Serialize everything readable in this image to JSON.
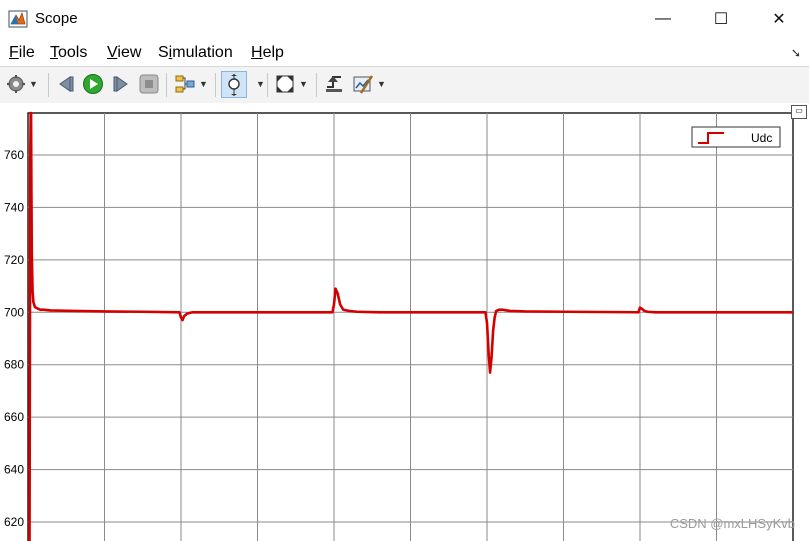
{
  "window": {
    "title": "Scope"
  },
  "window_controls": {
    "minimize": "—",
    "maximize": "☐",
    "close": "✕"
  },
  "menu": [
    {
      "label": "File",
      "accel": "F"
    },
    {
      "label": "Tools",
      "accel": "T"
    },
    {
      "label": "View",
      "accel": "V"
    },
    {
      "label": "Simulation",
      "accel": "i"
    },
    {
      "label": "Help",
      "accel": "H"
    }
  ],
  "toolbar": {
    "icons": [
      "settings-icon",
      "step-back-icon",
      "run-icon",
      "step-forward-icon",
      "stop-icon",
      "signal-select-icon",
      "zoom-icon",
      "autoscale-icon",
      "cursor-measure-icon",
      "style-icon"
    ]
  },
  "watermark": "CSDN @mxLHSyKvb",
  "chart_data": {
    "type": "line",
    "title": "",
    "xlabel": "",
    "ylabel": "",
    "ylim": [
      612,
      776
    ],
    "yticks": [
      620,
      640,
      660,
      680,
      700,
      720,
      740,
      760
    ],
    "x_grid_divisions": 10,
    "grid": true,
    "legend": {
      "placement": "top-right",
      "entries": [
        "Udc"
      ]
    },
    "series": [
      {
        "name": "Udc",
        "color": "#d40000",
        "x": [
          0.0,
          0.02,
          0.03,
          0.035,
          0.04,
          0.045,
          0.05,
          0.06,
          0.07,
          0.09,
          0.12,
          0.16,
          0.2,
          0.3,
          0.6,
          1.0,
          1.5,
          1.98,
          2.0,
          2.02,
          2.04,
          2.08,
          2.15,
          2.3,
          2.6,
          3.0,
          3.5,
          3.98,
          4.0,
          4.02,
          4.05,
          4.08,
          4.12,
          4.2,
          4.3,
          4.6,
          5.0,
          5.5,
          5.98,
          6.0,
          6.02,
          6.04,
          6.06,
          6.08,
          6.1,
          6.12,
          6.16,
          6.2,
          6.3,
          6.5,
          7.0,
          7.5,
          7.98,
          8.0,
          8.03,
          8.06,
          8.1,
          8.2,
          8.5,
          9.0,
          9.5,
          10.0
        ],
        "y": [
          612,
          612,
          760,
          776,
          776,
          745,
          722,
          708,
          704,
          702,
          701.5,
          701,
          701,
          700.7,
          700.5,
          700.3,
          700.2,
          700,
          698,
          697,
          698.5,
          699.5,
          700,
          700,
          700,
          700,
          700,
          700,
          703,
          709,
          707,
          703,
          701,
          700.5,
          700.2,
          700,
          700,
          700,
          700,
          696,
          685,
          677,
          683,
          693,
          698,
          700.5,
          701,
          701,
          700.5,
          700.3,
          700.2,
          700.1,
          700,
          701.8,
          701.2,
          700.5,
          700.2,
          700,
          700,
          700,
          700,
          700
        ]
      }
    ]
  }
}
